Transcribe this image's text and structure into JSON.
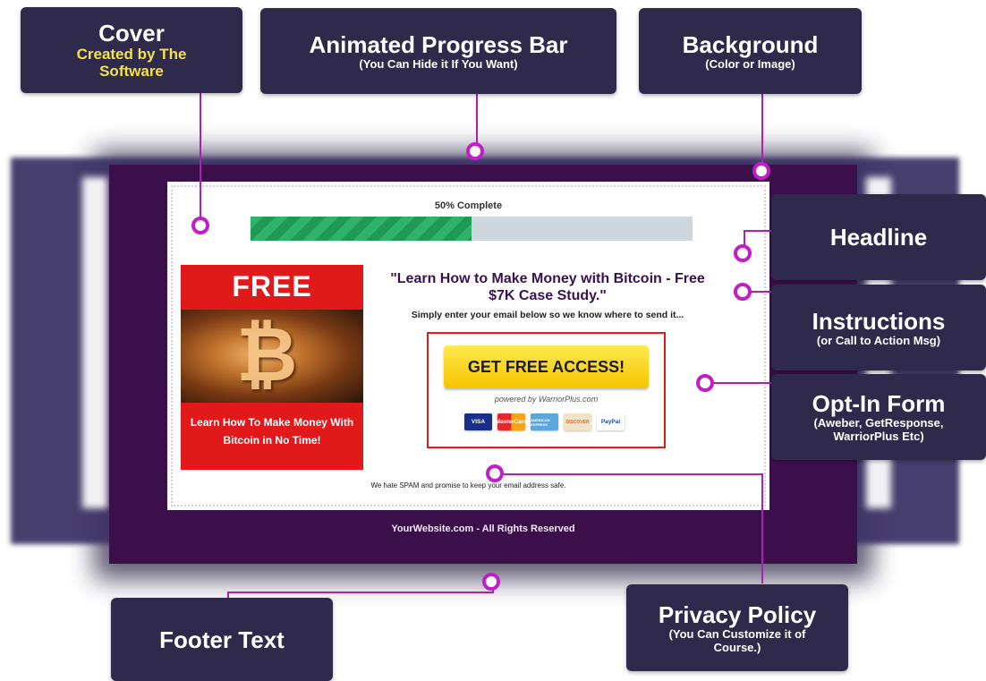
{
  "callouts": {
    "cover": {
      "title": "Cover",
      "subtitle": "Created by The Software"
    },
    "progress": {
      "title": "Animated Progress Bar",
      "subtitle": "(You Can Hide it If You Want)"
    },
    "background": {
      "title": "Background",
      "subtitle": "(Color or Image)"
    },
    "headline": {
      "title": "Headline"
    },
    "instructions": {
      "title": "Instructions",
      "subtitle": "(or Call to Action Msg)"
    },
    "optin": {
      "title": "Opt-In Form",
      "subtitle": "(Aweber, GetResponse, WarriorPlus Etc)"
    },
    "footer": {
      "title": "Footer Text"
    },
    "privacy": {
      "title": "Privacy Policy",
      "subtitle": "(You Can Customize it of Course.)"
    }
  },
  "squeeze_page": {
    "progress_label": "50% Complete",
    "progress_fraction": 0.5,
    "cover": {
      "free_label": "FREE",
      "coin_symbol": "₿",
      "text": "Learn How To Make Money With Bitcoin in No Time!"
    },
    "headline": "\"Learn How to Make Money with Bitcoin - Free $7K Case Study.\"",
    "instructions": "Simply enter your email below so we know where to send it...",
    "cta_label": "GET FREE ACCESS!",
    "powered_by": "powered by WarriorPlus.com",
    "payment_cards": [
      "VISA",
      "MasterCard",
      "AMERICAN EXPRESS",
      "DISCOVER",
      "PayPal"
    ],
    "spam_text": "We hate SPAM and promise to keep your email address safe.",
    "footer_text": "YourWebsite.com - All Rights Reserved"
  },
  "colors": {
    "page_background": "#3b0f4a",
    "callout_background": "#2f2a4c",
    "accent_pin": "#c01ec6",
    "progress_green": "#2fb36a",
    "cover_red": "#e1191b",
    "cta_yellow": "#f6c400"
  }
}
